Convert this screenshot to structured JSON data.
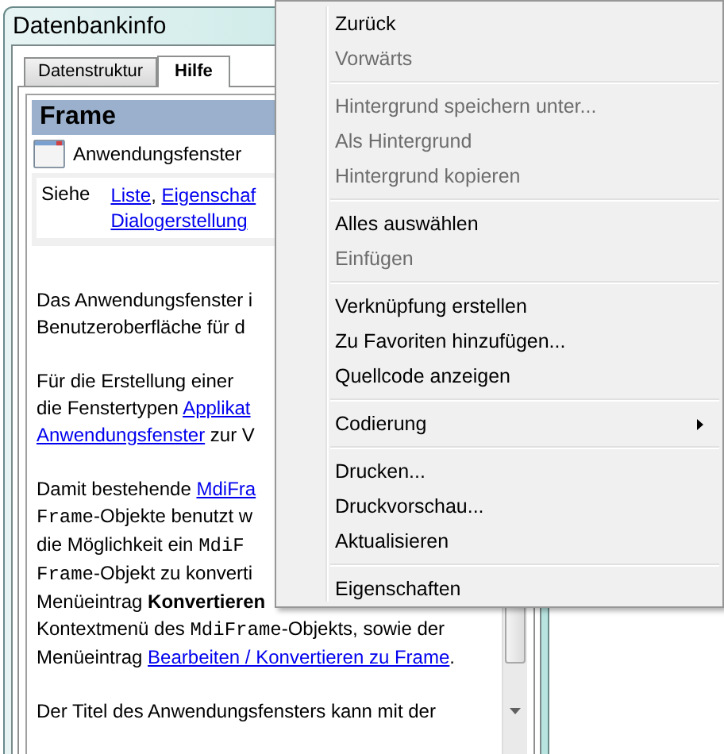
{
  "window": {
    "title": "Datenbankinfo"
  },
  "tabs": [
    {
      "label": "Datenstruktur",
      "selected": false
    },
    {
      "label": "Hilfe",
      "selected": true
    }
  ],
  "help": {
    "heading": "Frame",
    "type_label": "Anwendungsfenster",
    "see_label": "Siehe",
    "see_lines": [
      [
        {
          "kind": "link",
          "text": "Liste"
        },
        {
          "kind": "text",
          "text": ", "
        },
        {
          "kind": "link",
          "text": "Eigenschaf"
        }
      ],
      [
        {
          "kind": "link",
          "text": "Dialogerstellung"
        }
      ]
    ],
    "paragraphs": [
      [
        [
          {
            "kind": "text",
            "text": "Das Anwendungsfenster i"
          }
        ],
        [
          {
            "kind": "text",
            "text": "Benutzeroberfläche für d"
          }
        ]
      ],
      [
        [
          {
            "kind": "text",
            "text": "Für die Erstellung einer"
          }
        ],
        [
          {
            "kind": "text",
            "text": "die Fenstertypen "
          },
          {
            "kind": "link",
            "text": "Applikat"
          }
        ],
        [
          {
            "kind": "link",
            "text": "Anwendungsfenster"
          },
          {
            "kind": "text",
            "text": " zur V"
          }
        ]
      ],
      [
        [
          {
            "kind": "text",
            "text": "Damit bestehende "
          },
          {
            "kind": "link",
            "text": "MdiFra"
          }
        ],
        [
          {
            "kind": "code",
            "text": "Frame"
          },
          {
            "kind": "text",
            "text": "-Objekte benutzt w"
          }
        ],
        [
          {
            "kind": "text",
            "text": "die Möglichkeit ein "
          },
          {
            "kind": "code",
            "text": "MdiF"
          }
        ],
        [
          {
            "kind": "code",
            "text": "Frame"
          },
          {
            "kind": "text",
            "text": "-Objekt zu konverti"
          }
        ],
        [
          {
            "kind": "text",
            "text": "Menüeintrag "
          },
          {
            "kind": "strong",
            "text": "Konvertieren"
          }
        ],
        [
          {
            "kind": "text",
            "text": "Kontextmenü des "
          },
          {
            "kind": "code",
            "text": "MdiFrame"
          },
          {
            "kind": "text",
            "text": "-Objekts, sowie der"
          }
        ],
        [
          {
            "kind": "text",
            "text": "Menüeintrag "
          },
          {
            "kind": "link",
            "text": "Bearbeiten / Konvertieren zu Frame"
          },
          {
            "kind": "text",
            "text": "."
          }
        ]
      ],
      [
        [
          {
            "kind": "text",
            "text": "Der Titel des Anwendungsfensters kann mit der"
          }
        ]
      ]
    ]
  },
  "context_menu": [
    {
      "kind": "item",
      "label": "Zurück",
      "disabled": false,
      "submenu": false
    },
    {
      "kind": "item",
      "label": "Vorwärts",
      "disabled": true,
      "submenu": false
    },
    {
      "kind": "separator"
    },
    {
      "kind": "item",
      "label": "Hintergrund speichern unter...",
      "disabled": true,
      "submenu": false
    },
    {
      "kind": "item",
      "label": "Als Hintergrund",
      "disabled": true,
      "submenu": false
    },
    {
      "kind": "item",
      "label": "Hintergrund kopieren",
      "disabled": true,
      "submenu": false
    },
    {
      "kind": "separator"
    },
    {
      "kind": "item",
      "label": "Alles auswählen",
      "disabled": false,
      "submenu": false
    },
    {
      "kind": "item",
      "label": "Einfügen",
      "disabled": true,
      "submenu": false
    },
    {
      "kind": "separator"
    },
    {
      "kind": "item",
      "label": "Verknüpfung erstellen",
      "disabled": false,
      "submenu": false
    },
    {
      "kind": "item",
      "label": "Zu Favoriten hinzufügen...",
      "disabled": false,
      "submenu": false
    },
    {
      "kind": "item",
      "label": "Quellcode anzeigen",
      "disabled": false,
      "submenu": false
    },
    {
      "kind": "separator"
    },
    {
      "kind": "item",
      "label": "Codierung",
      "disabled": false,
      "submenu": true
    },
    {
      "kind": "separator"
    },
    {
      "kind": "item",
      "label": "Drucken...",
      "disabled": false,
      "submenu": false
    },
    {
      "kind": "item",
      "label": "Druckvorschau...",
      "disabled": false,
      "submenu": false
    },
    {
      "kind": "item",
      "label": "Aktualisieren",
      "disabled": false,
      "submenu": false
    },
    {
      "kind": "separator"
    },
    {
      "kind": "item",
      "label": "Eigenschaften",
      "disabled": false,
      "submenu": false
    }
  ]
}
